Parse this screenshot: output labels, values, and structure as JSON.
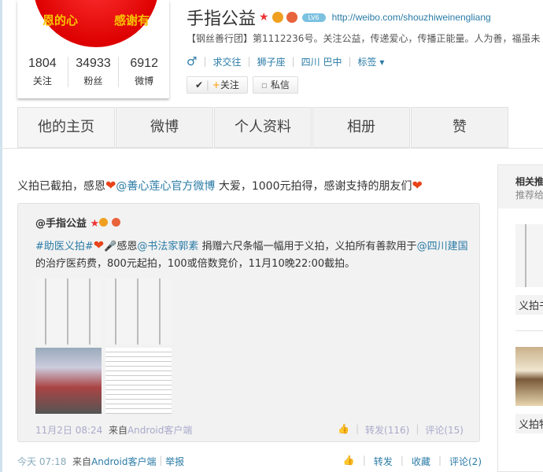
{
  "profile": {
    "name": "手指公益",
    "url": "http://weibo.com/shouzhiweinengliang",
    "level": "LV6",
    "description": "【钢丝善行团】第1112236号。关注公益，传递爱心，传播正能量。人为善，福虽未",
    "avatar_text": [
      "恩的心",
      "感谢有"
    ],
    "meta": [
      "♂",
      "求交往",
      "狮子座",
      "四川 巴中",
      "标签 ▾"
    ],
    "follow_label": "关注",
    "message_label": "私信",
    "stats": [
      {
        "value": "1804",
        "label": "关注"
      },
      {
        "value": "34933",
        "label": "粉丝"
      },
      {
        "value": "6912",
        "label": "微博"
      }
    ]
  },
  "tabs": [
    "他的主页",
    "微博",
    "个人资料",
    "相册",
    "赞"
  ],
  "post": {
    "text_before": "义拍已截拍，感恩",
    "mention": "@善心莲心官方微博",
    "text_after": " 大爱，1000元拍得，感谢支持的朋友们",
    "time": "今天 07:18",
    "source_prefix": "来自",
    "source": "Android客户端",
    "report": "举报",
    "forward": "转发",
    "favorite": "收藏",
    "comment": "评论(2)"
  },
  "repost": {
    "author": "@手指公益",
    "hashtag": "#助医义拍#",
    "t1": "感恩",
    "m1": "@书法家郭素",
    "t2": " 捐赠六尺条幅一幅用于义拍，义拍所有善款用于",
    "m2": "@四川建国",
    "t3": "的治疗医药费，800元起拍，100或倍数竞价，11月10晚22:00截拍。",
    "time": "11月2日 08:24",
    "source_prefix": "来自",
    "source": "Android客户端",
    "forward": "转发(116)",
    "comment": "评论(15)"
  },
  "sidebar": {
    "title": "相关推荐",
    "subtitle": "推荐给你",
    "items": [
      "义拍书法",
      "义拍物品"
    ]
  }
}
